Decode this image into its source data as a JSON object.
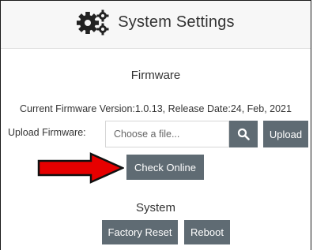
{
  "header": {
    "title": "System Settings",
    "icon": "gears-icon"
  },
  "firmware": {
    "section_title": "Firmware",
    "info": "Current Firmware Version:1.0.13, Release Date:24, Feb, 2021",
    "upload_label": "Upload Firmware:",
    "file_placeholder": "Choose a file...",
    "search_icon": "search-icon",
    "upload_label_button": "Upload",
    "check_online_label": "Check Online",
    "annotation_arrow_color": "#e60000"
  },
  "system": {
    "section_title": "System",
    "factory_reset_label": "Factory Reset",
    "reboot_label": "Reboot"
  },
  "colors": {
    "button_bg": "#5f6b73",
    "header_bg": "#f7f7f7"
  }
}
